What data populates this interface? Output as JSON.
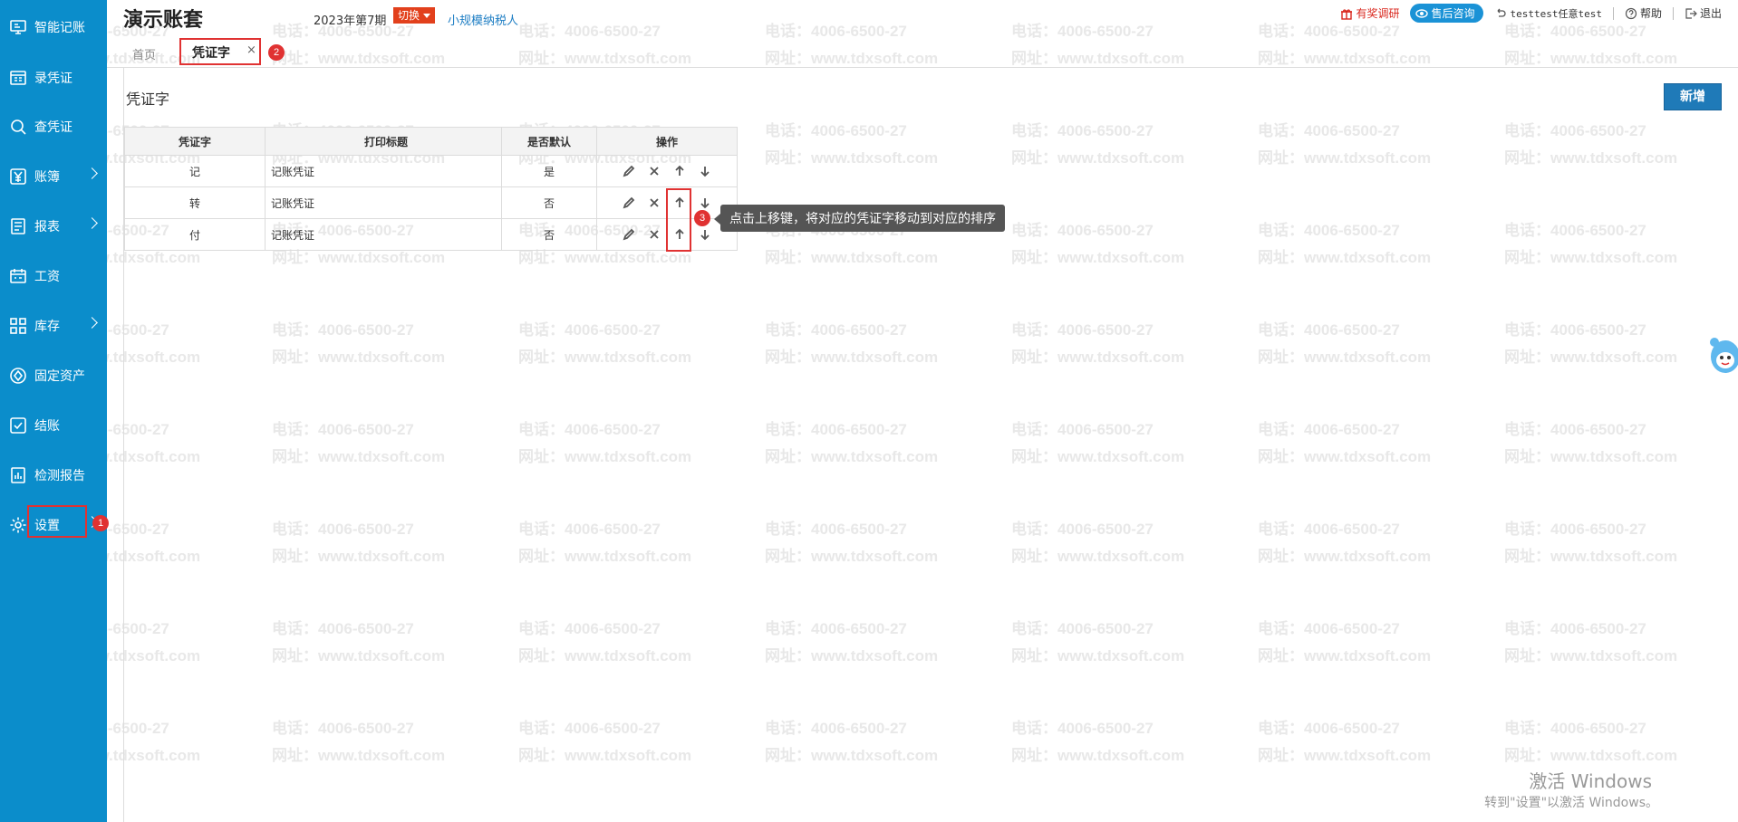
{
  "sidebar": {
    "items": [
      {
        "label": "智能记账",
        "icon": "monitor-icon",
        "has_arrow": false
      },
      {
        "label": "录凭证",
        "icon": "voucher-entry-icon",
        "has_arrow": false
      },
      {
        "label": "查凭证",
        "icon": "search-icon",
        "has_arrow": false
      },
      {
        "label": "账簿",
        "icon": "yen-icon",
        "has_arrow": true
      },
      {
        "label": "报表",
        "icon": "report-icon",
        "has_arrow": true
      },
      {
        "label": "工资",
        "icon": "calendar-icon",
        "has_arrow": false
      },
      {
        "label": "库存",
        "icon": "grid-icon",
        "has_arrow": true
      },
      {
        "label": "固定资产",
        "icon": "asset-icon",
        "has_arrow": false
      },
      {
        "label": "结账",
        "icon": "check-icon",
        "has_arrow": false
      },
      {
        "label": "检测报告",
        "icon": "chart-icon",
        "has_arrow": false
      },
      {
        "label": "设置",
        "icon": "gear-icon",
        "has_arrow": false
      }
    ]
  },
  "header": {
    "brand": "演示账套",
    "period": "2023年第7期",
    "switch_label": "切换",
    "taxpayer": "小规模纳税人",
    "survey": "有奖调研",
    "consult": "售后咨询",
    "user": "testtest任意test",
    "help": "帮助",
    "logout": "退出"
  },
  "tabs": {
    "home": "首页",
    "active": "凭证字",
    "close": "×"
  },
  "page": {
    "title": "凭证字",
    "add_button": "新增"
  },
  "table": {
    "headers": [
      "凭证字",
      "打印标题",
      "是否默认",
      "操作"
    ],
    "rows": [
      {
        "word": "记",
        "title": "记账凭证",
        "default": "是"
      },
      {
        "word": "转",
        "title": "记账凭证",
        "default": "否"
      },
      {
        "word": "付",
        "title": "记账凭证",
        "default": "否"
      }
    ]
  },
  "steps": {
    "s1": "1",
    "s2": "2",
    "s3": "3"
  },
  "tooltip": "点击上移键，将对应的凭证字移动到对应的排序",
  "watermark": {
    "phone": "电话：4006-6500-27",
    "site": "网址：www.tdxsoft.com"
  },
  "windows": {
    "line1": "激活 Windows",
    "line2": "转到\"设置\"以激活 Windows。"
  },
  "colors": {
    "sidebar": "#0b8dcb",
    "accent_red": "#e03232",
    "primary_button": "#1f7ab8"
  }
}
